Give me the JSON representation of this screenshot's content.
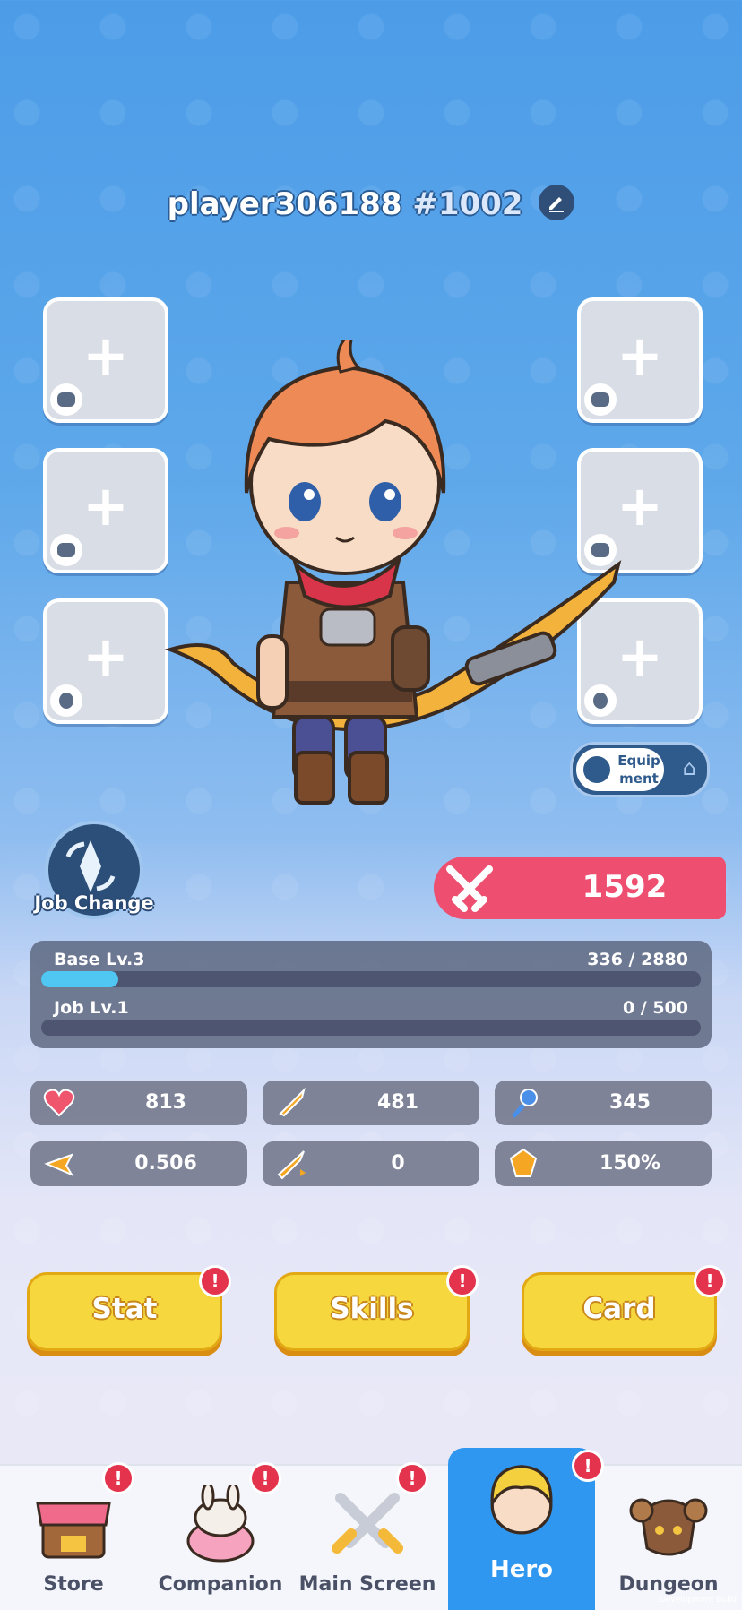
{
  "header": {
    "player_name": "player306188",
    "player_tag": "#1002",
    "edit_icon": "pencil-icon"
  },
  "equip_slots": {
    "left": [
      {
        "icon": "weapon-icon",
        "plus": "+"
      },
      {
        "icon": "armor-icon",
        "plus": "+"
      },
      {
        "icon": "ring-icon",
        "plus": "+"
      }
    ],
    "right": [
      {
        "icon": "helmet-icon",
        "plus": "+"
      },
      {
        "icon": "boots-icon",
        "plus": "+"
      },
      {
        "icon": "necklace-icon",
        "plus": "+"
      }
    ]
  },
  "equipment_toggle": {
    "label": "Equip ment",
    "icon_left": "helmet-icon",
    "icon_right": "hanger-icon"
  },
  "job_change": {
    "label": "Job Change"
  },
  "combat_power": {
    "value": "1592",
    "icon": "crossed-swords-icon"
  },
  "levels": {
    "base": {
      "label": "Base Lv.3",
      "value": "336 / 2880",
      "progress": 0.117
    },
    "job": {
      "label": "Job Lv.1",
      "value": "0 / 500",
      "progress": 0
    }
  },
  "stats": [
    {
      "icon": "heart-icon",
      "value": "813",
      "color": "#f0556e"
    },
    {
      "icon": "attack-icon",
      "value": "481",
      "color": "#f5a623"
    },
    {
      "icon": "magic-icon",
      "value": "345",
      "color": "#4a8fe8"
    },
    {
      "icon": "speed-icon",
      "value": "0.506",
      "color": "#f5a623"
    },
    {
      "icon": "crit-icon",
      "value": "0",
      "color": "#f5a623"
    },
    {
      "icon": "crit-damage-icon",
      "value": "150%",
      "color": "#f5a623"
    }
  ],
  "actions": [
    {
      "label": "Stat",
      "badge": "!"
    },
    {
      "label": "Skills",
      "badge": "!"
    },
    {
      "label": "Card",
      "badge": "!"
    }
  ],
  "nav": [
    {
      "label": "Store",
      "badge": "!",
      "active": false
    },
    {
      "label": "Companion",
      "badge": "!",
      "active": false
    },
    {
      "label": "Main Screen",
      "badge": "!",
      "active": false
    },
    {
      "label": "Hero",
      "badge": "!",
      "active": true
    },
    {
      "label": "Dungeon",
      "badge": "",
      "active": false
    }
  ],
  "footer": {
    "build": "Development Build"
  }
}
